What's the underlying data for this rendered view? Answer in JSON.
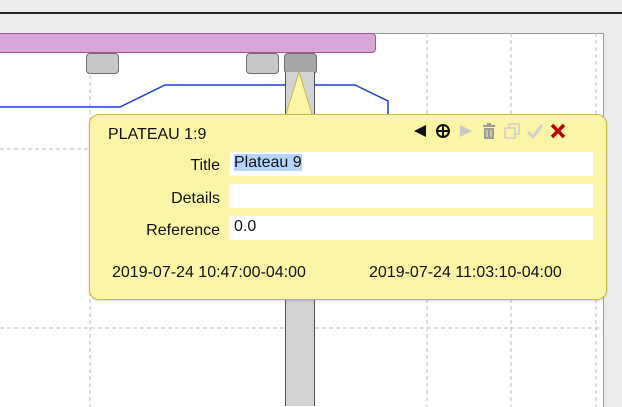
{
  "callout": {
    "title": "PLATEAU 1:9",
    "fields": {
      "title_label": "Title",
      "title_value": "Plateau 9",
      "details_label": "Details",
      "details_value": "",
      "reference_label": "Reference",
      "reference_value": "0.0"
    },
    "start_time": "2019-07-24 10:47:00-04:00",
    "end_time": "2019-07-24 11:03:10-04:00",
    "toolbar_icons": [
      "previous-icon",
      "pan-icon",
      "next-icon",
      "delete-icon",
      "duplicate-icon",
      "confirm-icon",
      "close-icon"
    ]
  },
  "colors": {
    "callout_background": "#fbf5a7",
    "series_line": "#1a3de0",
    "range_bar": "#d9a6d8",
    "close": "#b50000",
    "selection": "#b5d5ff"
  }
}
